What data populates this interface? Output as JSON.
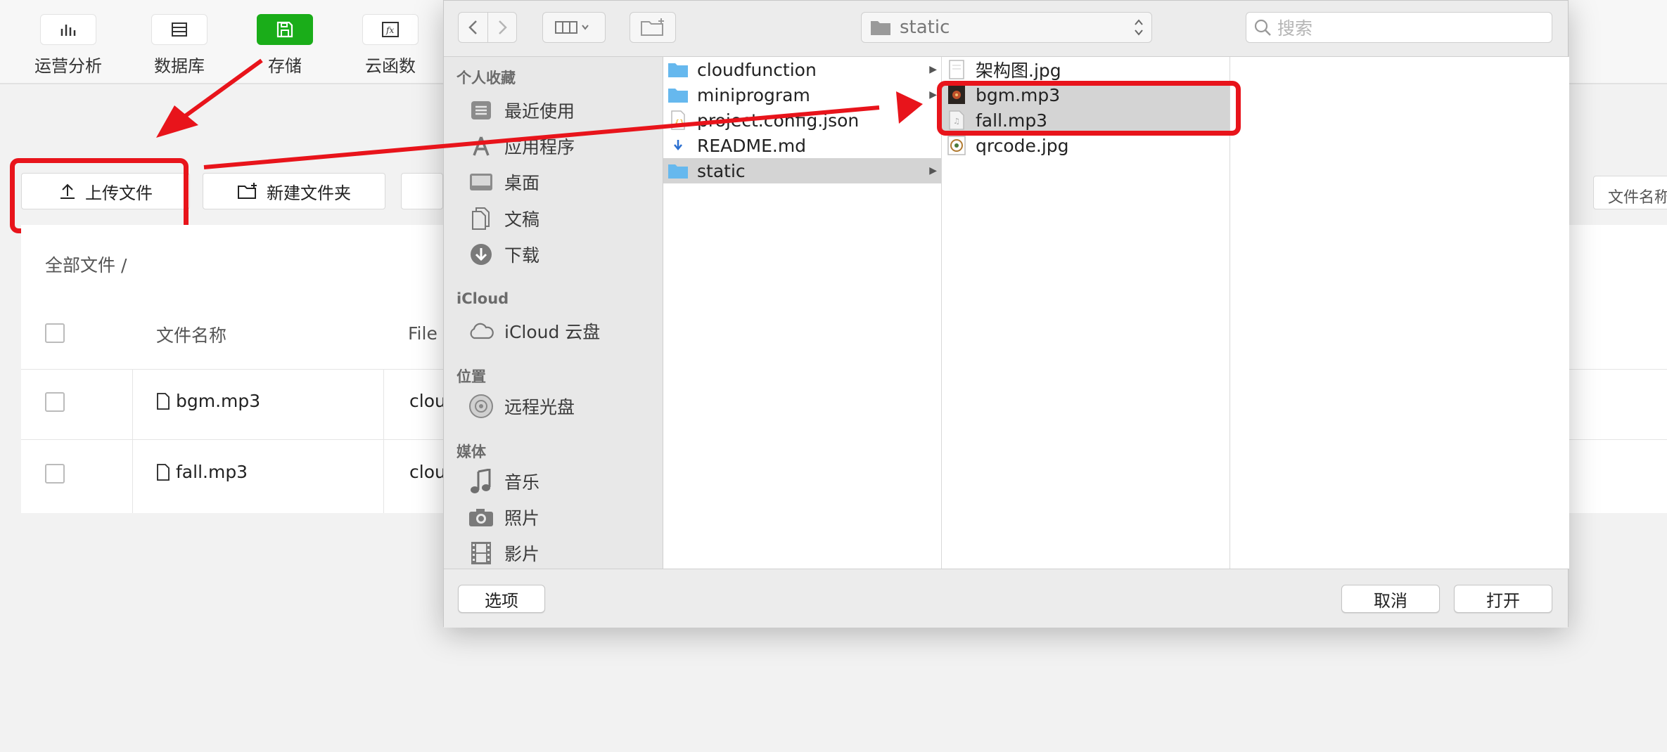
{
  "nav": {
    "items": [
      {
        "label": "运营分析",
        "icon": "bar-chart-icon"
      },
      {
        "label": "数据库",
        "icon": "database-icon"
      },
      {
        "label": "存储",
        "icon": "storage-icon",
        "active": true
      },
      {
        "label": "云函数",
        "icon": "function-icon"
      }
    ]
  },
  "toolbar": {
    "upload_label": "上传文件",
    "new_folder_label": "新建文件夹",
    "search_placeholder": "文件名称"
  },
  "files_panel": {
    "breadcrumb": "全部文件  /",
    "headers": {
      "name": "文件名称",
      "file": "File"
    },
    "rows": [
      {
        "name": "bgm.mp3",
        "file_id": "clou"
      },
      {
        "name": "fall.mp3",
        "file_id": "clou"
      }
    ]
  },
  "dialog": {
    "path": "static",
    "search_placeholder": "搜索",
    "sidebar": {
      "favorites_heading": "个人收藏",
      "favorites": [
        "最近使用",
        "应用程序",
        "桌面",
        "文稿",
        "下载"
      ],
      "icloud_heading": "iCloud",
      "icloud": [
        "iCloud 云盘"
      ],
      "locations_heading": "位置",
      "locations": [
        "远程光盘"
      ],
      "media_heading": "媒体",
      "media": [
        "音乐",
        "照片",
        "影片"
      ]
    },
    "column1": [
      {
        "name": "cloudfunction",
        "type": "folder"
      },
      {
        "name": "miniprogram",
        "type": "folder"
      },
      {
        "name": "project.config.json",
        "type": "json"
      },
      {
        "name": "README.md",
        "type": "md"
      },
      {
        "name": "static",
        "type": "folder",
        "selected": true
      }
    ],
    "column2": [
      {
        "name": "架构图.jpg",
        "type": "image"
      },
      {
        "name": "bgm.mp3",
        "type": "audio",
        "selected": true
      },
      {
        "name": "fall.mp3",
        "type": "audio",
        "selected": true
      },
      {
        "name": "qrcode.jpg",
        "type": "image"
      }
    ],
    "options_label": "选项",
    "cancel_label": "取消",
    "open_label": "打开"
  },
  "colors": {
    "accent_green": "#1aad19",
    "annotation_red": "#e8141b"
  }
}
